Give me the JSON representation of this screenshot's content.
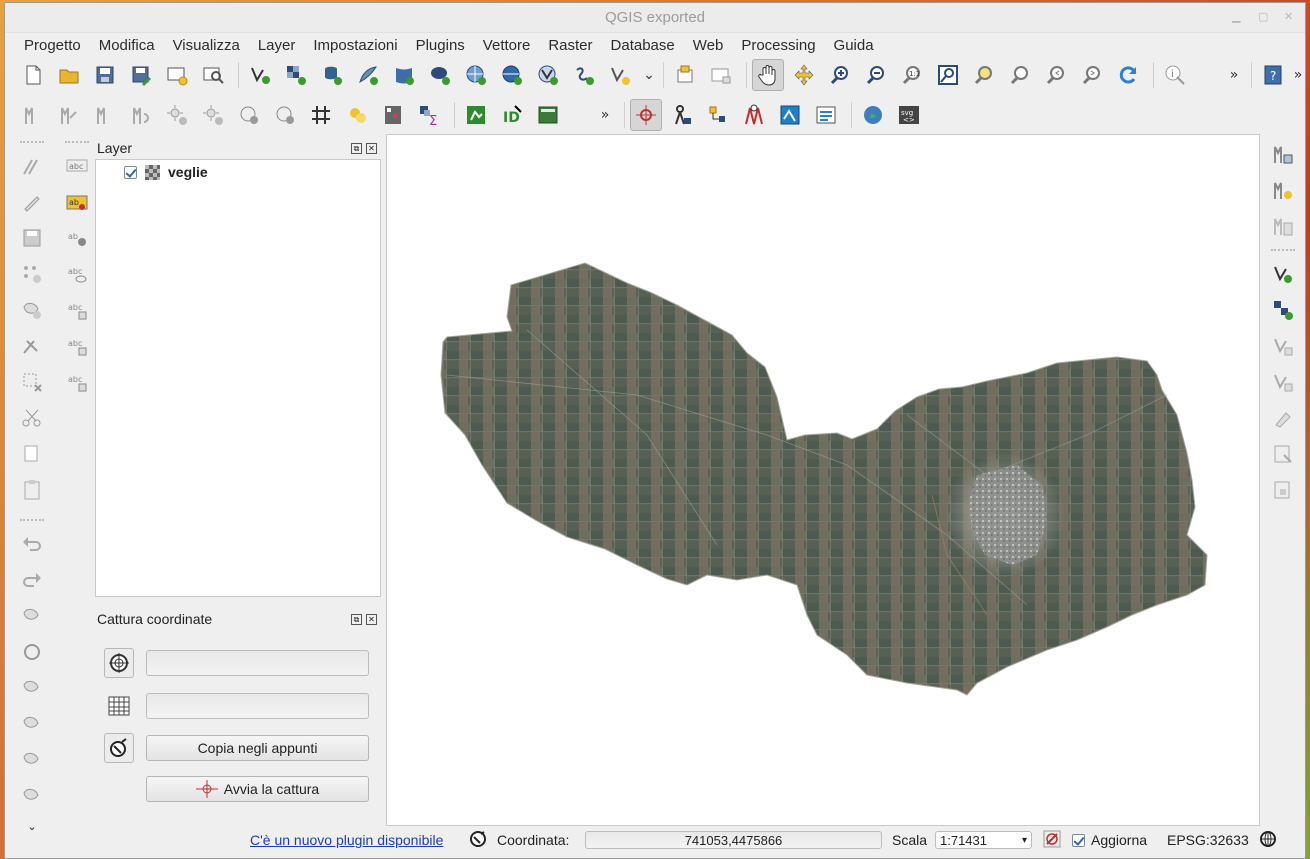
{
  "window": {
    "title": "QGIS exported"
  },
  "menubar": {
    "items": [
      "Progetto",
      "Modifica",
      "Visualizza",
      "Layer",
      "Impostazioni",
      "Plugins",
      "Vettore",
      "Raster",
      "Database",
      "Web",
      "Processing",
      "Guida"
    ]
  },
  "toolbar": {
    "overflow": "»"
  },
  "layers_panel": {
    "title": "Layer",
    "layers": [
      {
        "name": "veglie",
        "checked": true,
        "type": "raster"
      }
    ]
  },
  "capture_panel": {
    "title": "Cattura coordinate",
    "field1_value": "",
    "field2_value": "",
    "copy_label": "Copia negli appunti",
    "start_label": "Avvia la cattura"
  },
  "statusbar": {
    "plugin_link": "C'è un nuovo plugin disponibile",
    "coord_label": "Coordinata:",
    "coord_value": "741053,4475866",
    "scale_label": "Scala",
    "scale_value": "1:71431",
    "update_label": "Aggiorna",
    "crs": "EPSG:32633"
  },
  "colors": {
    "accent": "#3565a8",
    "link": "#1a3fb8",
    "map_background": "#ffffff",
    "raster_tone": "#5d6256"
  }
}
